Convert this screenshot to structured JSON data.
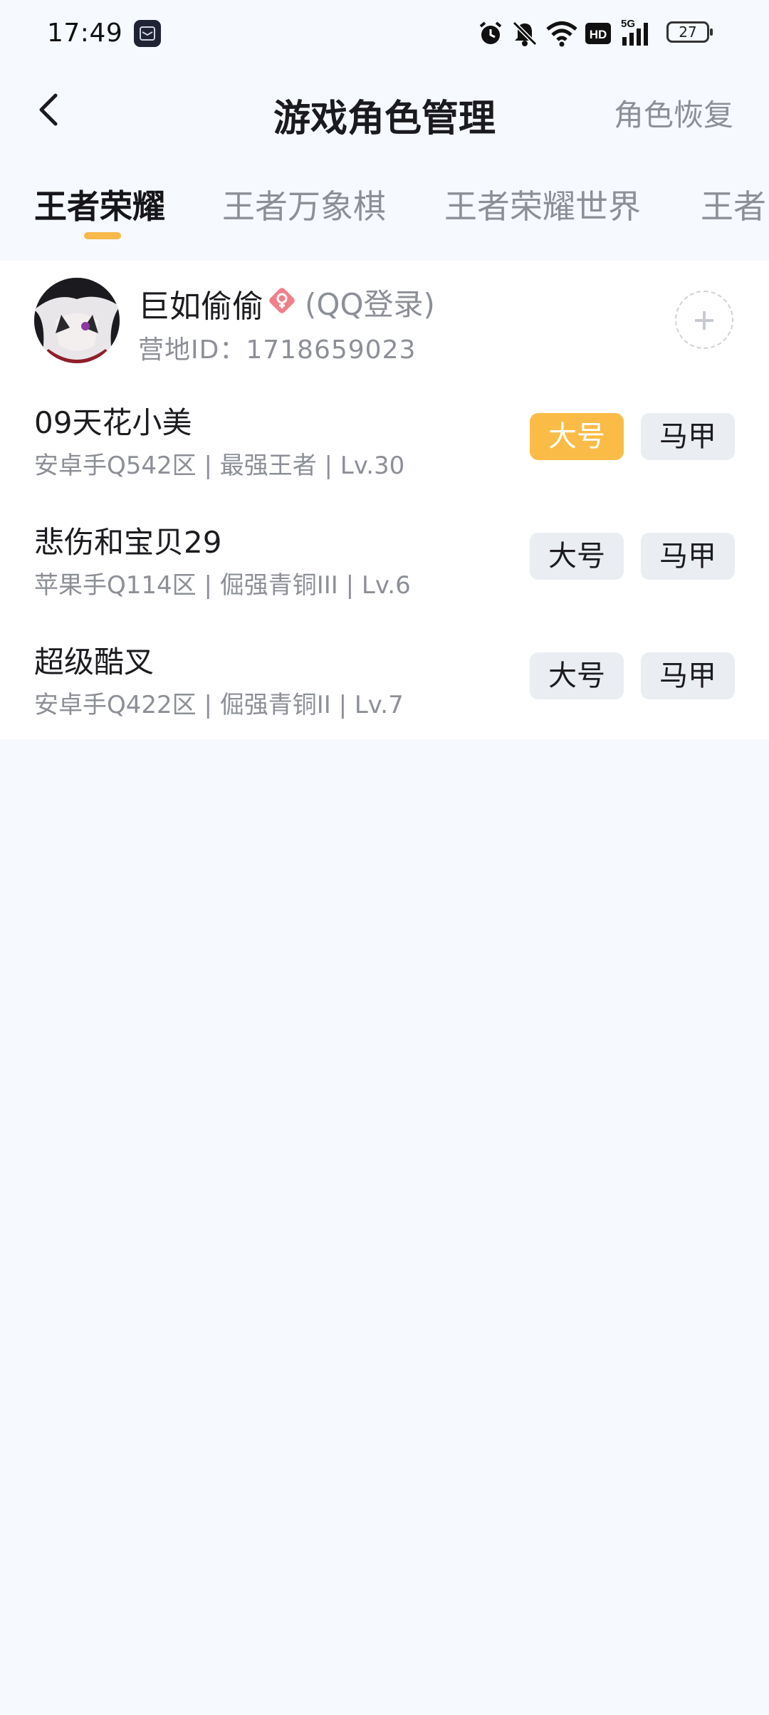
{
  "status_bar": {
    "time": "17:49",
    "battery": "27",
    "icons": [
      "app-notification-icon",
      "alarm-icon",
      "mute-icon",
      "wifi-icon",
      "hd-icon",
      "5g-signal-icon",
      "battery-icon"
    ],
    "hd_label": "HD",
    "network_label": "5G"
  },
  "header": {
    "title": "游戏角色管理",
    "action": "角色恢复",
    "back_icon": "back-arrow-icon"
  },
  "tabs": [
    {
      "label": "王者荣耀",
      "active": true
    },
    {
      "label": "王者万象棋",
      "active": false
    },
    {
      "label": "王者荣耀世界",
      "active": false
    },
    {
      "label": "王者",
      "active": false
    }
  ],
  "account": {
    "name": "巨如偷偷",
    "gender_icon": "female-icon",
    "login_type": "(QQ登录)",
    "camp_id": "营地ID：1718659023",
    "add_icon": "plus-icon"
  },
  "roles": [
    {
      "name": "09天花小美",
      "info": "安卓手Q542区 | 最强王者 | Lv.30",
      "main_label": "大号",
      "alt_label": "马甲",
      "is_main": true
    },
    {
      "name": "悲伤和宝贝29",
      "info": "苹果手Q114区 | 倔强青铜III | Lv.6",
      "main_label": "大号",
      "alt_label": "马甲",
      "is_main": false
    },
    {
      "name": "超级酷叉",
      "info": "安卓手Q422区 | 倔强青铜II | Lv.7",
      "main_label": "大号",
      "alt_label": "马甲",
      "is_main": false
    }
  ],
  "colors": {
    "accent": "#fbbc47",
    "background": "#f6f9fe",
    "card": "#ffffff",
    "secondary_text": "#8c8f96"
  }
}
